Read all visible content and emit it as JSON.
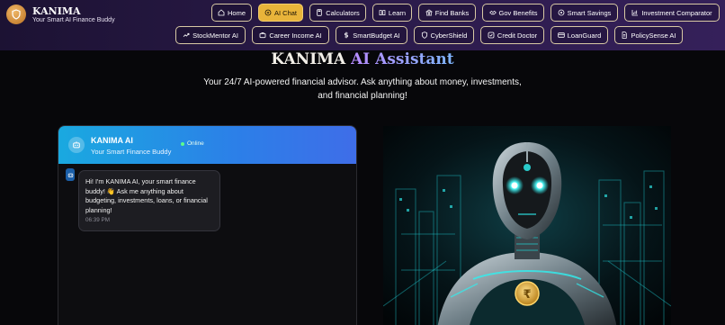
{
  "brand": {
    "name": "KANIMA",
    "tagline": "Your Smart AI Finance Buddy",
    "logo_icon": "shield-icon"
  },
  "nav": {
    "row1": [
      {
        "label": "Home",
        "icon": "home-icon",
        "active": false
      },
      {
        "label": "AI Chat",
        "icon": "chat-icon",
        "active": true
      },
      {
        "label": "Calculators",
        "icon": "calculator-icon",
        "active": false
      },
      {
        "label": "Learn",
        "icon": "book-icon",
        "active": false
      },
      {
        "label": "Find Banks",
        "icon": "bank-icon",
        "active": false
      },
      {
        "label": "Gov Benefits",
        "icon": "handshake-icon",
        "active": false
      },
      {
        "label": "Smart Savings",
        "icon": "savings-icon",
        "active": false
      },
      {
        "label": "Investment Comparator",
        "icon": "chart-icon",
        "active": false
      }
    ],
    "row2": [
      {
        "label": "StockMentor AI",
        "icon": "trend-icon"
      },
      {
        "label": "Career Income AI",
        "icon": "briefcase-icon"
      },
      {
        "label": "SmartBudget AI",
        "icon": "dollar-icon"
      },
      {
        "label": "CyberShield",
        "icon": "shield-icon"
      },
      {
        "label": "Credit Doctor",
        "icon": "badge-icon"
      },
      {
        "label": "LoanGuard",
        "icon": "card-icon"
      },
      {
        "label": "PolicySense AI",
        "icon": "document-icon"
      }
    ]
  },
  "hero": {
    "title_part1": "KANIMA ",
    "title_part2": "AI Assistant",
    "subtitle": "Your 24/7 AI-powered financial advisor. Ask anything about money, investments, and financial planning!"
  },
  "chat": {
    "name": "KANIMA AI",
    "subtitle": "Your Smart Finance Buddy",
    "status": "Online",
    "messages": [
      {
        "text": "Hi! I'm KANIMA AI, your smart finance buddy! 👋 Ask me anything about budgeting, investments, loans, or financial planning!",
        "time": "06:39 PM"
      }
    ]
  },
  "colors": {
    "accent": "#e8b43a",
    "chat_header": "#2c7fe8",
    "online": "#5dfb8c",
    "robot_glow": "#27e6e6"
  }
}
